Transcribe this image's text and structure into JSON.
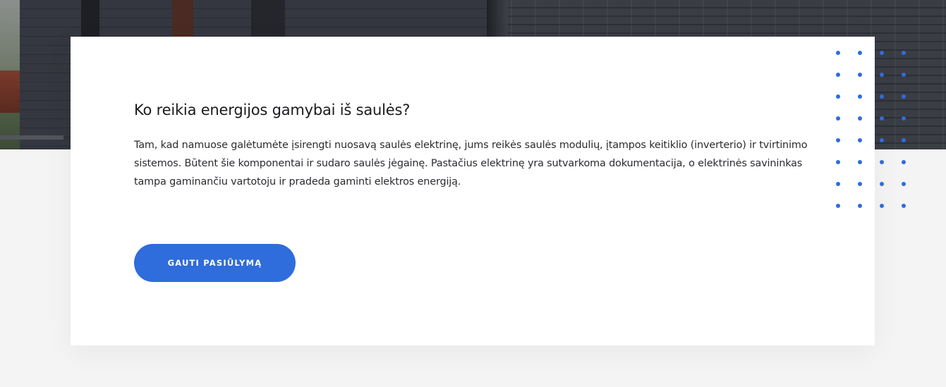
{
  "content": {
    "title": "Ko reikia energijos gamybai iš saulės?",
    "paragraph": "Tam, kad namuose galėtumėte įsirengti nuosavą saulės elektrinę, jums reikės saulės modulių, įtampos keitiklio (inverterio) ir tvirtinimo sistemos. Būtent šie komponentai ir sudaro saulės jėgainę. Pastačius elektrinę yra sutvarkoma dokumentacija, o elektrinės savininkas tampa gaminančiu vartotoju ir pradeda gaminti elektros energiją.",
    "cta_label": "GAUTI PASIŪLYMĄ"
  },
  "colors": {
    "accent": "#2f6cdc",
    "dots": "#2f6cdc",
    "page_background": "#f4f4f4",
    "card_background": "#ffffff"
  },
  "decoration": {
    "dot_grid": {
      "columns": 4,
      "rows": 8
    }
  }
}
